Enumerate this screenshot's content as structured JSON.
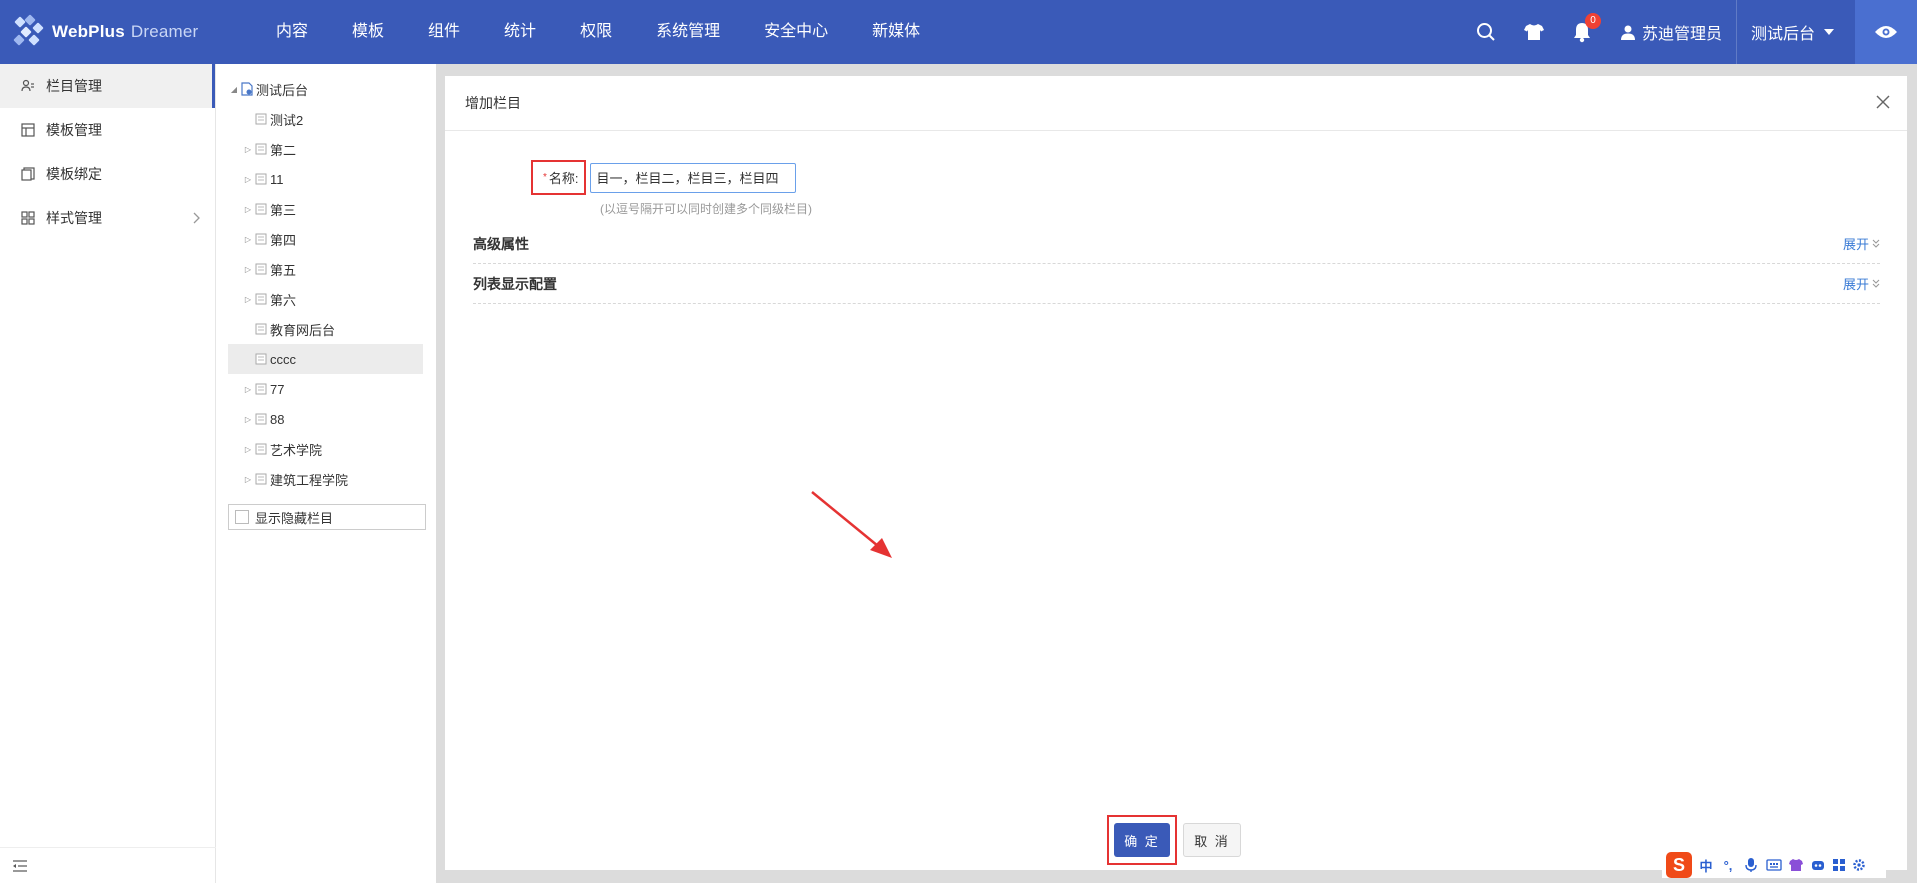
{
  "app": {
    "brand": "WebPlus",
    "brand_sub": "Dreamer"
  },
  "nav": [
    "内容",
    "模板",
    "组件",
    "统计",
    "权限",
    "系统管理",
    "安全中心",
    "新媒体"
  ],
  "header": {
    "notification_count": "0",
    "user_name": "苏迪管理员",
    "site_name": "测试后台"
  },
  "sidebar": {
    "items": [
      {
        "label": "栏目管理",
        "icon": "columns-icon"
      },
      {
        "label": "模板管理",
        "icon": "template-icon"
      },
      {
        "label": "模板绑定",
        "icon": "bind-icon"
      },
      {
        "label": "样式管理",
        "icon": "style-icon"
      }
    ]
  },
  "tree": {
    "root": "测试后台",
    "children": [
      "测试2",
      "第二",
      "11",
      "第三",
      "第四",
      "第五",
      "第六",
      "教育网后台",
      "cccc",
      "77",
      "88",
      "艺术学院",
      "建筑工程学院"
    ],
    "show_hidden_label": "显示隐藏栏目"
  },
  "dialog": {
    "title": "增加栏目",
    "name_required_mark": "*",
    "name_label": "名称:",
    "name_value": "目一，栏目二，栏目三，栏目四",
    "hint": "(以逗号隔开可以同时创建多个同级栏目)",
    "sections": [
      {
        "title": "高级属性",
        "action": "展开"
      },
      {
        "title": "列表显示配置",
        "action": "展开"
      }
    ],
    "confirm_label": "确 定",
    "cancel_label": "取 消"
  },
  "ime": {
    "lang": "中",
    "punct": "°,"
  }
}
